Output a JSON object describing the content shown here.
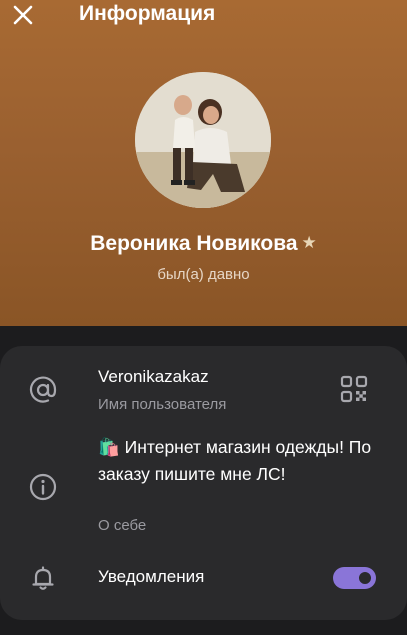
{
  "header": {
    "title": "Информация",
    "close_icon": "close-icon"
  },
  "profile": {
    "name": "Вероника Новикова",
    "star": "★",
    "status": "был(а) давно"
  },
  "info": {
    "username": "Veronikazakaz",
    "username_label": "Имя пользователя",
    "bio": "🛍️ Интернет магазин одежды! По заказу пишите мне ЛС!",
    "bio_label": "О себе",
    "notifications_label": "Уведомления",
    "notifications_enabled": true
  },
  "colors": {
    "header_top": "#a86a33",
    "header_bottom": "#8a5526",
    "card_bg": "#2a2a2c",
    "accent": "#8a75d8",
    "secondary_text": "#9a9aa0"
  }
}
